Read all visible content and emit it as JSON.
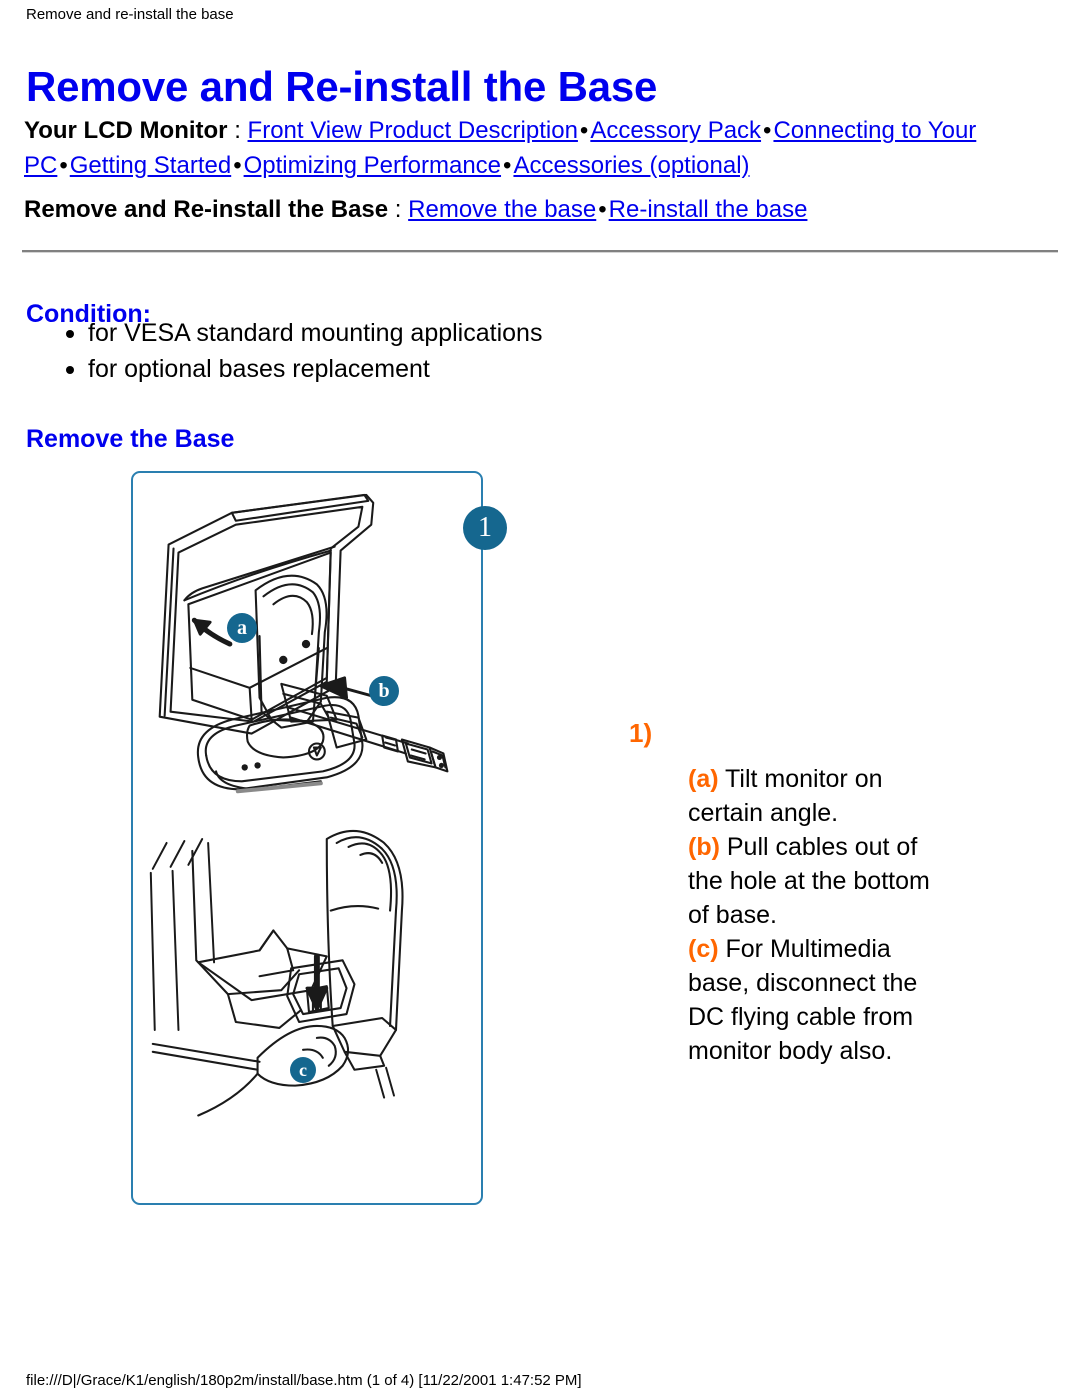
{
  "header": {
    "running_title": "Remove and re-install the base",
    "page_title": "Remove and Re-install the Base"
  },
  "nav": {
    "primary": {
      "lead": "Your LCD Monitor",
      "colon": " : ",
      "links": [
        "Front View Product Description",
        "Accessory Pack",
        "Connecting to Your PC",
        "Getting Started",
        "Optimizing Performance",
        "Accessories (optional)"
      ],
      "separator": "•"
    },
    "secondary": {
      "lead": "Remove and Re-install the Base",
      "colon": " : ",
      "links": [
        "Remove the base",
        "Re-install the base"
      ],
      "separator": "•"
    }
  },
  "content": {
    "condition_heading": "Condition:",
    "condition_bullets": [
      "for VESA standard mounting applications",
      "for optional bases replacement"
    ],
    "remove_base_heading": "Remove the Base"
  },
  "illustration": {
    "badges": {
      "step": "1",
      "a": "a",
      "b": "b",
      "c": "c"
    },
    "frame_border_color": "#2a7fb0",
    "badge_color": "#15678f",
    "line_art_color": "#1a1a1a"
  },
  "steps": {
    "number": "1)",
    "items": [
      {
        "label": "(a)",
        "text": " Tilt monitor on certain angle."
      },
      {
        "label": "(b)",
        "text": " Pull cables out of the hole at the bottom of base."
      },
      {
        "label": "(c)",
        "text": " For Multimedia base, disconnect the DC flying cable from monitor body also."
      }
    ],
    "accent_color": "#ff6600"
  },
  "footer": {
    "path": "file:///D|/Grace/K1/english/180p2m/install/base.htm (1 of 4) [11/22/2001 1:47:52 PM]"
  }
}
